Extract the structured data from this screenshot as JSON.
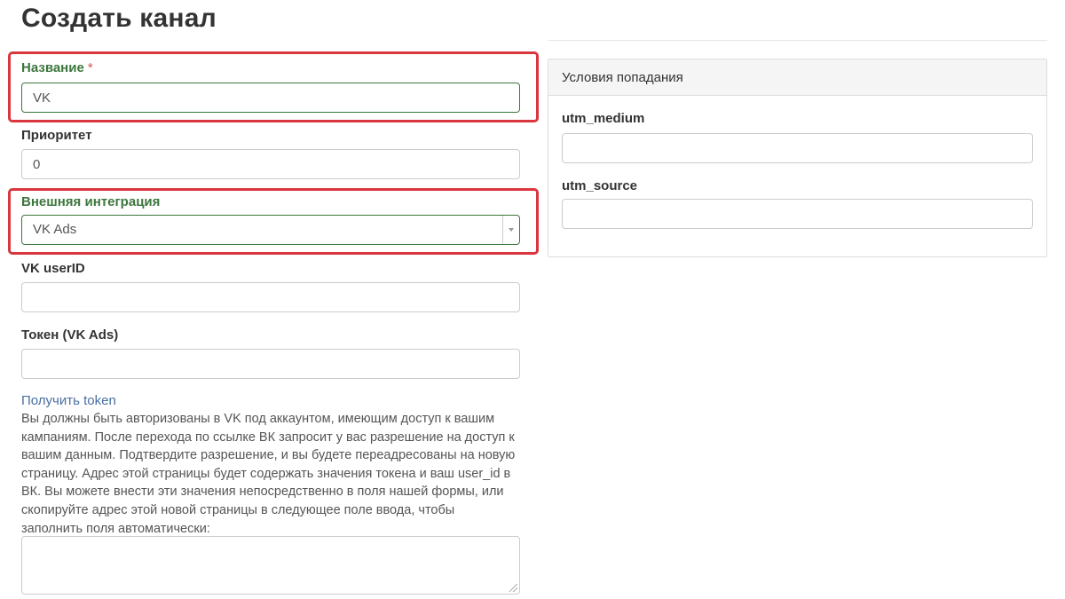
{
  "page": {
    "title": "Создать канал"
  },
  "form": {
    "name": {
      "label": "Название",
      "required_mark": "*",
      "value": "VK"
    },
    "priority": {
      "label": "Приоритет",
      "value": "0"
    },
    "integration": {
      "label": "Внешняя интеграция",
      "value": "VK Ads"
    },
    "vk_user_id": {
      "label": "VK userID",
      "value": ""
    },
    "token": {
      "label": "Токен (VK Ads)",
      "value": ""
    },
    "get_token_link": "Получить token",
    "help_text": "Вы должны быть авторизованы в VK под аккаунтом, имеющим доступ к вашим кампаниям. После перехода по ссылке ВК запросит у вас разрешение на доступ к вашим данным. Подтвердите разрешение, и вы будете переадресованы на новую страницу. Адрес этой страницы будет содержать значения токена и ваш user_id в ВК. Вы можете внести эти значения непосредственно в поля нашей формы, или скопируйте адрес этой новой страницы в следующее поле ввода, чтобы заполнить поля автоматически:",
    "url_textarea": {
      "value": ""
    }
  },
  "conditions_panel": {
    "heading": "Условия попадания",
    "utm_medium": {
      "label": "utm_medium",
      "value": ""
    },
    "utm_source": {
      "label": "utm_source",
      "value": ""
    }
  },
  "colors": {
    "success_green": "#3c763d",
    "highlight_red": "#d9363e",
    "required_red": "#d9534f",
    "link_blue": "#4a6fa0"
  },
  "icons": {
    "select_arrow": "caret-down-icon",
    "resize": "resize-grip-icon"
  }
}
